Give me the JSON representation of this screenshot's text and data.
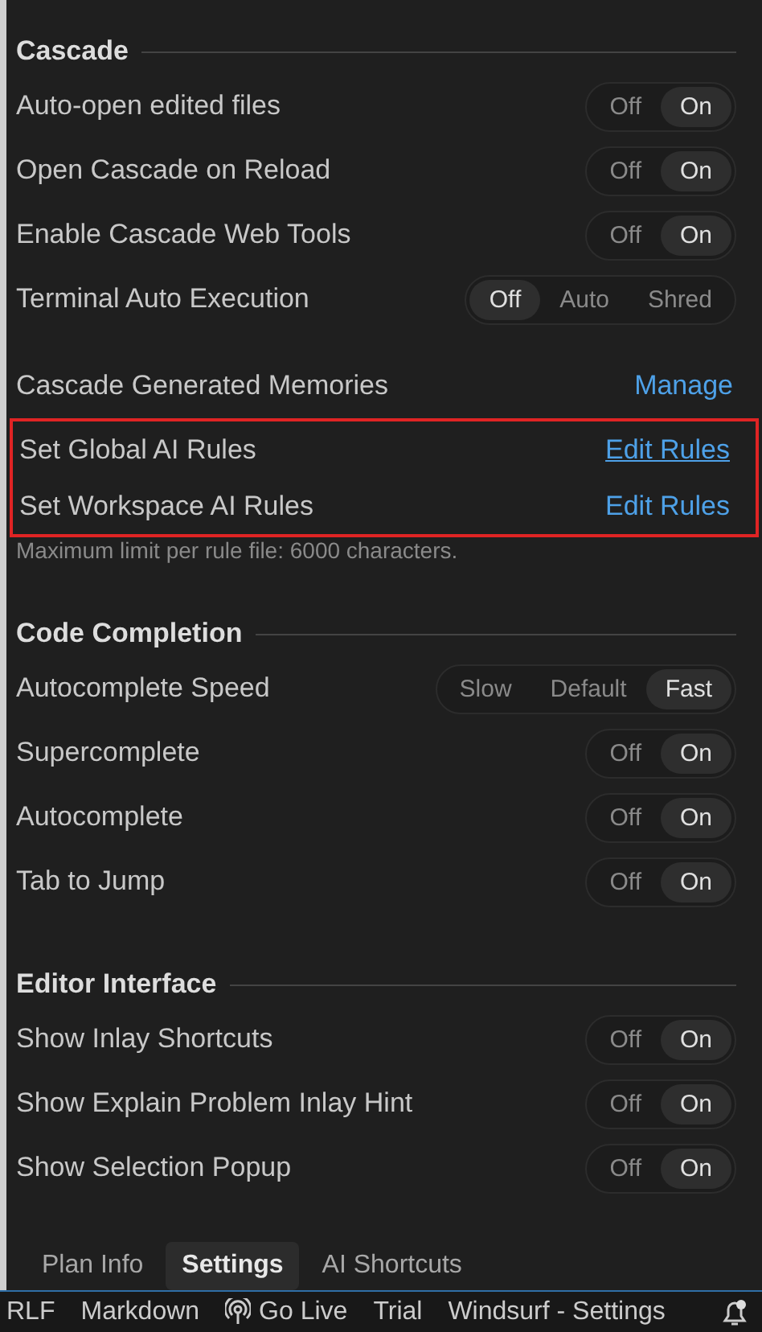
{
  "sections": [
    {
      "title": "Cascade",
      "items": [
        {
          "kind": "toggle",
          "label": "Auto-open edited files",
          "options": [
            {
              "label": "Off",
              "selected": false
            },
            {
              "label": "On",
              "selected": true
            }
          ]
        },
        {
          "kind": "toggle",
          "label": "Open Cascade on Reload",
          "options": [
            {
              "label": "Off",
              "selected": false
            },
            {
              "label": "On",
              "selected": true
            }
          ]
        },
        {
          "kind": "toggle",
          "label": "Enable Cascade Web Tools",
          "options": [
            {
              "label": "Off",
              "selected": false
            },
            {
              "label": "On",
              "selected": true
            }
          ]
        },
        {
          "kind": "toggle",
          "label": "Terminal Auto Execution",
          "options": [
            {
              "label": "Off",
              "selected": true
            },
            {
              "label": "Auto",
              "selected": false
            },
            {
              "label": "Shred",
              "selected": false
            }
          ]
        },
        {
          "kind": "link",
          "label": "Cascade Generated Memories",
          "link": "Manage",
          "underlined": false
        },
        {
          "kind": "group",
          "outlined": true,
          "rows": [
            {
              "label": "Set Global AI Rules",
              "link": "Edit Rules",
              "underlined": true
            },
            {
              "label": "Set Workspace AI Rules",
              "link": "Edit Rules",
              "underlined": false
            }
          ]
        },
        {
          "kind": "note",
          "text": "Maximum limit per rule file: 6000 characters."
        }
      ]
    },
    {
      "title": "Code Completion",
      "items": [
        {
          "kind": "toggle",
          "label": "Autocomplete Speed",
          "options": [
            {
              "label": "Slow",
              "selected": false
            },
            {
              "label": "Default",
              "selected": false
            },
            {
              "label": "Fast",
              "selected": true
            }
          ]
        },
        {
          "kind": "toggle",
          "label": "Supercomplete",
          "options": [
            {
              "label": "Off",
              "selected": false
            },
            {
              "label": "On",
              "selected": true
            }
          ]
        },
        {
          "kind": "toggle",
          "label": "Autocomplete",
          "options": [
            {
              "label": "Off",
              "selected": false
            },
            {
              "label": "On",
              "selected": true
            }
          ]
        },
        {
          "kind": "toggle",
          "label": "Tab to Jump",
          "options": [
            {
              "label": "Off",
              "selected": false
            },
            {
              "label": "On",
              "selected": true
            }
          ]
        }
      ]
    },
    {
      "title": "Editor Interface",
      "items": [
        {
          "kind": "toggle",
          "label": "Show Inlay Shortcuts",
          "options": [
            {
              "label": "Off",
              "selected": false
            },
            {
              "label": "On",
              "selected": true
            }
          ]
        },
        {
          "kind": "toggle",
          "label": "Show Explain Problem Inlay Hint",
          "options": [
            {
              "label": "Off",
              "selected": false
            },
            {
              "label": "On",
              "selected": true
            }
          ]
        },
        {
          "kind": "toggle",
          "label": "Show Selection Popup",
          "options": [
            {
              "label": "Off",
              "selected": false
            },
            {
              "label": "On",
              "selected": true
            }
          ]
        }
      ]
    }
  ],
  "tabs": [
    {
      "label": "Plan Info",
      "selected": false
    },
    {
      "label": "Settings",
      "selected": true
    },
    {
      "label": "AI Shortcuts",
      "selected": false
    }
  ],
  "status_bar": [
    {
      "kind": "text",
      "label": "RLF"
    },
    {
      "kind": "text",
      "label": "Markdown"
    },
    {
      "kind": "live",
      "label": "Go Live"
    },
    {
      "kind": "text",
      "label": "Trial"
    },
    {
      "kind": "text",
      "label": "Windsurf - Settings"
    },
    {
      "kind": "bell"
    }
  ]
}
